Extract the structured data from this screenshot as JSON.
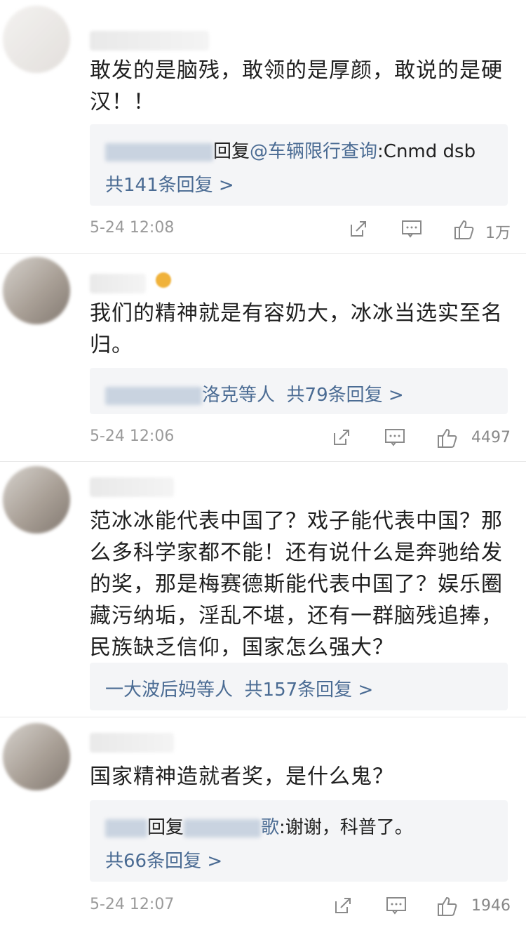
{
  "comments": [
    {
      "text_lines": [
        "敢发的是脑残，敢领的是厚颜，敢说的是硬",
        "汉！！"
      ],
      "reply_preview": {
        "action": "回复",
        "mention": "@车辆限行查询",
        "content": ":Cnmd dsb"
      },
      "total": "共141条回复 >",
      "time": "5-24 12:08",
      "likes": "1万"
    },
    {
      "text_lines": [
        "我们的精神就是有容奶大，冰冰当选实至名",
        "归。"
      ],
      "reply_summary": {
        "names": "洛克等人",
        "total": "共79条回复 >"
      },
      "time": "5-24 12:06",
      "likes": "4497"
    },
    {
      "text_lines": [
        "范冰冰能代表中国了？戏子能代表中国？那",
        "么多科学家都不能！还有说什么是奔驰给发",
        "的奖，那是梅赛德斯能代表中国了？娱乐圈",
        "藏污纳垢，淫乱不堪，还有一群脑残追捧，",
        "民族缺乏信仰，国家怎么强大？"
      ],
      "reply_summary": {
        "names": "一大波后妈等人",
        "total": "共157条回复 >"
      },
      "time": "",
      "likes": ""
    },
    {
      "text_lines": [
        "国家精神造就者奖，是什么鬼？"
      ],
      "reply_preview": {
        "action": "回复",
        "mention": "歌",
        "content": ":谢谢，科普了。"
      },
      "total": "共66条回复 >",
      "time": "5-24 12:07",
      "likes": "1946"
    }
  ]
}
